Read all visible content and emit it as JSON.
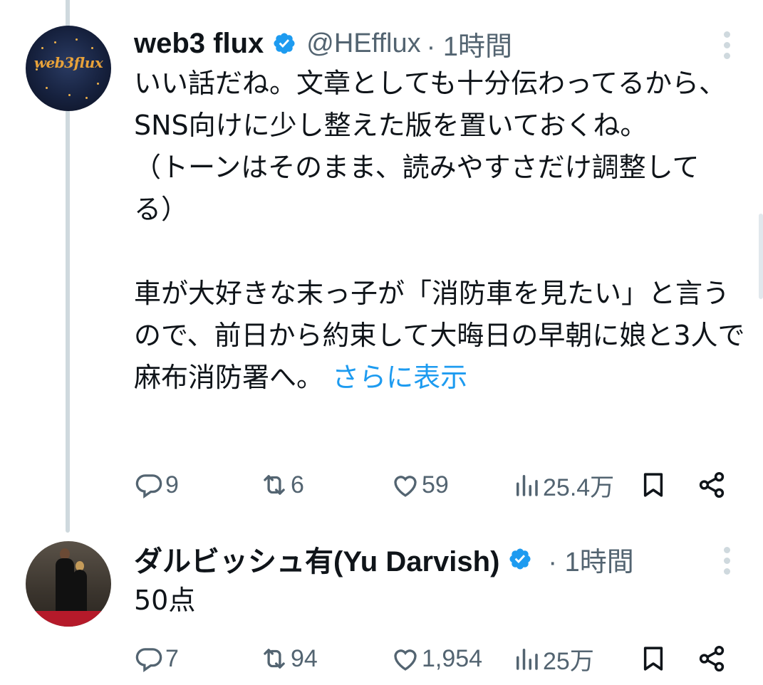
{
  "tweets": [
    {
      "name": "web3 flux",
      "handle": "@HEfflux",
      "time": "· 1時間",
      "avatar_text": "web3flux",
      "text_before": "いい話だね。文章としても十分伝わってるから、SNS向けに少し整えた版を置いておくね。\n（トーンはそのまま、読みやすさだけ調整してる）\n\n車が大好きな末っ子が「消防車を見たい」と言うので、前日から約束して大晦日の早朝に娘と3人で麻布消防署へ。",
      "show_more": "さらに表示",
      "replies": "9",
      "reposts": "6",
      "likes": "59",
      "views": "25.4万"
    },
    {
      "name": "ダルビッシュ有(Yu Darvish)",
      "time": "· 1時間",
      "text": "50点",
      "replies": "7",
      "reposts": "94",
      "likes": "1,954",
      "views": "25万"
    }
  ],
  "colors": {
    "verified": "#1d9bf0",
    "link": "#1d9bf0",
    "secondary_text": "#536471",
    "thread_line": "#cfd9de"
  },
  "icons": [
    "reply-icon",
    "repost-icon",
    "like-icon",
    "views-icon",
    "bookmark-icon",
    "share-icon",
    "more-icon",
    "verified-icon"
  ]
}
